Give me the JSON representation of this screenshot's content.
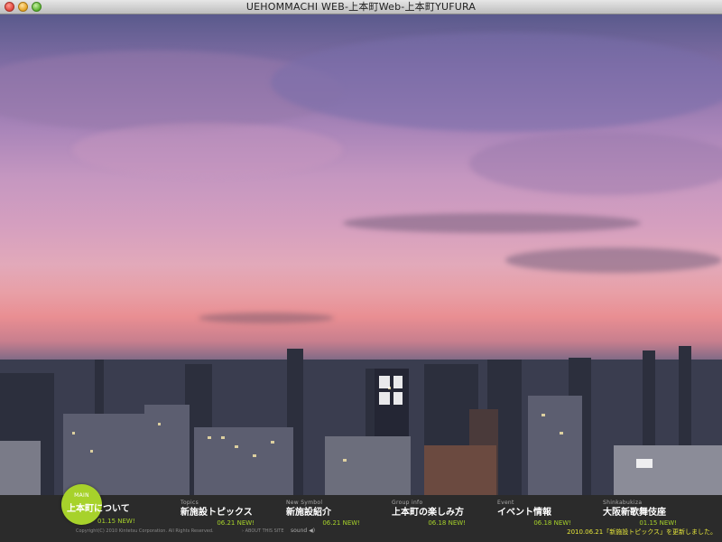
{
  "window": {
    "title": "UEHOMMACHI WEB-上本町Web-上本町YUFURA"
  },
  "nav": {
    "main": {
      "category": "MAIN",
      "title": "上本町について",
      "date": "01.15 NEW!"
    },
    "items": [
      {
        "category": "Topics",
        "title": "新施設トピックス",
        "date": "06.21 NEW!"
      },
      {
        "category": "New Symbol",
        "title": "新施設紹介",
        "date": "06.21 NEW!"
      },
      {
        "category": "Group info",
        "title": "上本町の楽しみ方",
        "date": "06.18 NEW!"
      },
      {
        "category": "Event",
        "title": "イベント情報",
        "date": "06.18 NEW!"
      },
      {
        "category": "Shinkabukiza",
        "title": "大阪新歌舞伎座",
        "date": "01.15 NEW!"
      }
    ]
  },
  "footer": {
    "copyright": "Copyright(C) 2010 Kintetsu Corporation. All Rights Reserved.",
    "about": "› ABOUT THIS SITE",
    "sound": "sound",
    "sound_icon": "speaker-icon",
    "news": "2010.06.21「新施設トピックス」を更新しました。"
  },
  "colors": {
    "accent": "#a7d22b",
    "news": "#e5e53a",
    "navbar": "#2b2b2b"
  }
}
